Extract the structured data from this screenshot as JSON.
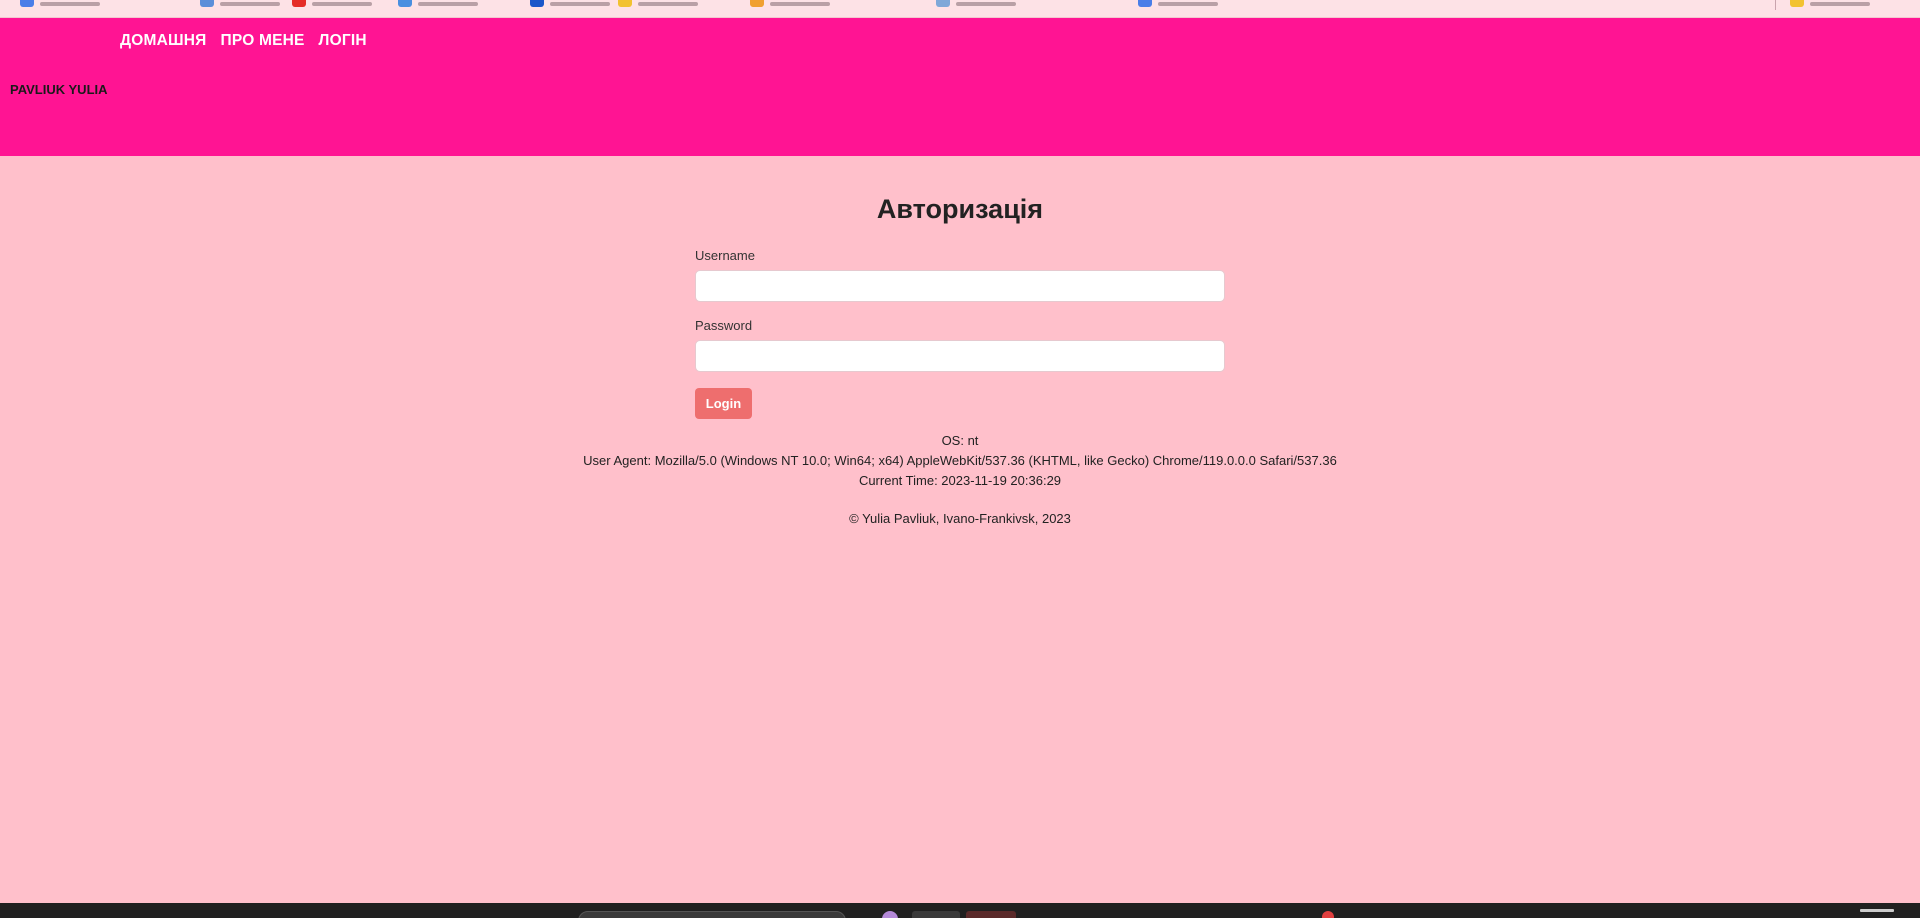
{
  "nav": {
    "home": "ДОМАШНЯ",
    "about": "ПРО МЕНЕ",
    "login": "ЛОГІН"
  },
  "brand": "PAVLIUK YULIA",
  "login_form": {
    "title": "Авторизація",
    "username_label": "Username",
    "username_value": "",
    "password_label": "Password",
    "password_value": "",
    "submit_label": "Login"
  },
  "info": {
    "os": "OS: nt",
    "user_agent": "User Agent: Mozilla/5.0 (Windows NT 10.0; Win64; x64) AppleWebKit/537.36 (KHTML, like Gecko) Chrome/119.0.0.0 Safari/537.36",
    "current_time": "Current Time: 2023-11-19 20:36:29"
  },
  "footer": "© Yulia Pavliuk, Ivano-Frankivsk, 2023",
  "colors": {
    "header_bg": "#ff1493",
    "page_bg": "#ffc0cb",
    "button_bg": "#ee6e6e"
  }
}
